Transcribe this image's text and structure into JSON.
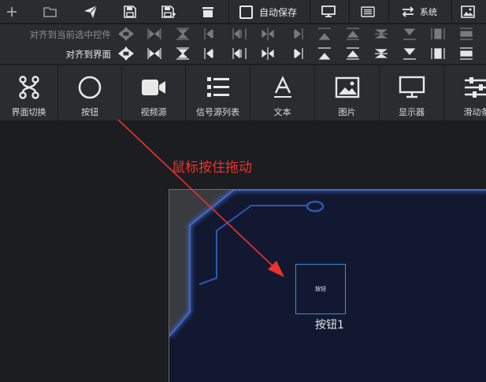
{
  "toolbar": {
    "icons": [
      "add-icon",
      "folder-open-icon",
      "send-icon",
      "save-icon",
      "save-as-icon",
      "delete-icon",
      "monitor-icon",
      "list-icon",
      "swap-icon",
      "image-icon"
    ],
    "autosave_label": "自动保存",
    "autosave_checked": false,
    "system_label": "系统"
  },
  "align": {
    "row1_label": "对齐到当前选中控件",
    "row2_label": "对齐到界面",
    "row1_enabled": false,
    "row2_enabled": true
  },
  "palette": {
    "items": [
      {
        "label": "界面切换",
        "icon": "page-switch-icon"
      },
      {
        "label": "按钮",
        "icon": "circle-button-icon"
      },
      {
        "label": "视频源",
        "icon": "video-camera-icon"
      },
      {
        "label": "信号源列表",
        "icon": "list-icon"
      },
      {
        "label": "文本",
        "icon": "text-icon"
      },
      {
        "label": "图片",
        "icon": "picture-icon"
      },
      {
        "label": "显示器",
        "icon": "monitor-icon"
      },
      {
        "label": "滑动条",
        "icon": "slider-icon"
      }
    ]
  },
  "canvas": {
    "annotation": "鼠标按住拖动",
    "button_text": "按钮",
    "button_name": "按钮1"
  },
  "colors": {
    "toolbar_bg": "#2b2c30",
    "workspace_bg": "#1c1d20",
    "stage_bg": "#141a2e",
    "stage_glow": "#3e63c8",
    "selection": "#3c8ee0",
    "annotation": "#e8332f"
  }
}
